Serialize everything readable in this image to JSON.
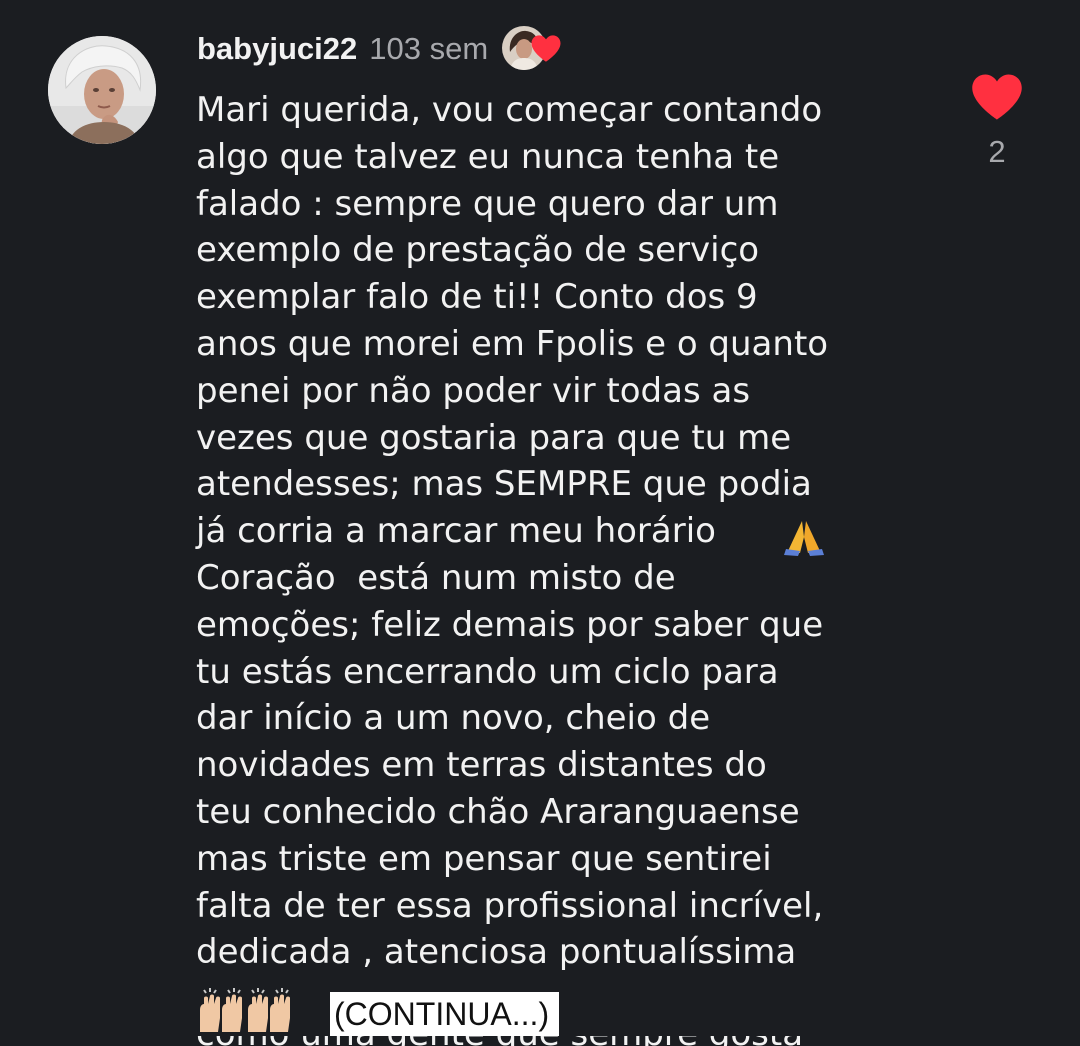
{
  "comment": {
    "username": "babyjuci22",
    "timestamp": "103 sem",
    "text": "Mari querida, vou começar contando\nalgo que talvez eu nunca tenha te\nfalado : sempre que quero dar um\nexemplo de prestação de serviço\nexemplar falo de ti!! Conto dos 9\nanos que morei em Fpolis e o quanto\npenei por não poder vir todas as\nvezes que gostaria para que tu me\natendesses; mas SEMPRE que podia\njá corria a marcar meu horário\nCoração  está num misto de\nemoções; feliz demais por saber que\ntu estás encerrando um ciclo para\ndar início a um novo, cheio de\nnovidades em terras distantes do\nteu conhecido chão Araranguaense\nmas triste em pensar que sentirei\nfalta de ter essa profissional incrível,\ndedicada , atenciosa pontualíssima",
    "highlight_label": "(CONTINUA...)",
    "like_count": "2",
    "colors": {
      "background": "#1b1d21",
      "text": "#f2f2f2",
      "muted": "#a8a9ad",
      "heart": "#ff3040"
    },
    "icons": {
      "avatar": "profile-photo",
      "liked_by": "creator-liked-avatar",
      "liked_heart": "heart-icon",
      "like": "heart-icon",
      "pray": "folded-hands-emoji",
      "raise": "raising-hands-emoji"
    }
  }
}
